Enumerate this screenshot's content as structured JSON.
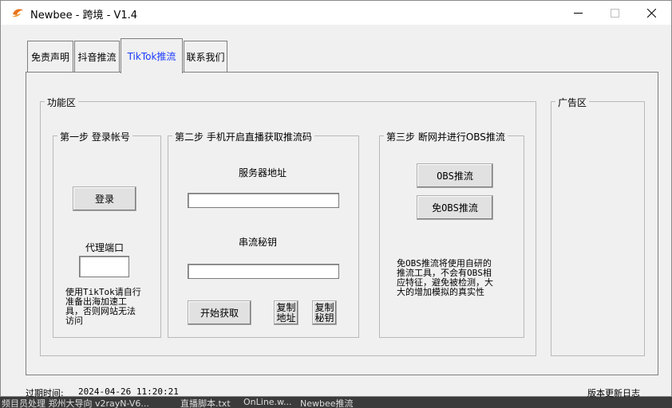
{
  "window": {
    "title": "Newbee - 跨境 - V1.4"
  },
  "tabs": [
    {
      "label": "免责声明",
      "active": false
    },
    {
      "label": "抖音推流",
      "active": false
    },
    {
      "label": "TikTok推流",
      "active": true
    },
    {
      "label": "联系我们",
      "active": false
    }
  ],
  "function_area": {
    "title": "功能区",
    "step1": {
      "title": "第一步 登录帐号",
      "login_label": "登录",
      "proxy_port_label": "代理端口",
      "proxy_port_value": "",
      "note_lines": [
        "使用TikTok请自行",
        "准备出海加速工",
        "具，否则网站无法",
        "访问"
      ]
    },
    "step2": {
      "title": "第二步 手机开启直播获取推流码",
      "server_label": "服务器地址",
      "server_value": "",
      "key_label": "串流秘钥",
      "key_value": "",
      "start_label": "开始获取",
      "copy_addr_lines": [
        "复制",
        "地址"
      ],
      "copy_key_lines": [
        "复制",
        "秘钥"
      ]
    },
    "step3": {
      "title": "第三步 断网并进行OBS推流",
      "obs_label": "OBS推流",
      "no_obs_label": "免OBS推流",
      "note_lines": [
        "免OBS推流将使用自研的",
        "推流工具，不会有OBS相",
        "应特征，避免被检测，大",
        "大的增加模拟的真实性"
      ]
    }
  },
  "ad_area": {
    "title": "广告区"
  },
  "status": {
    "expiry_label": "过期时间:",
    "expiry_value": "2024-04-26 11:20:21",
    "changelog_label": "版本更新日志"
  },
  "background_taskbar": [
    "频目员处理 郑州大导向 v2rayN-V6...",
    "直播脚本.txt",
    "OnLine.w...",
    "Newbee推流"
  ],
  "colors": {
    "active_tab_text": "#1a3aff",
    "window_bg": "#f0f0f0"
  }
}
